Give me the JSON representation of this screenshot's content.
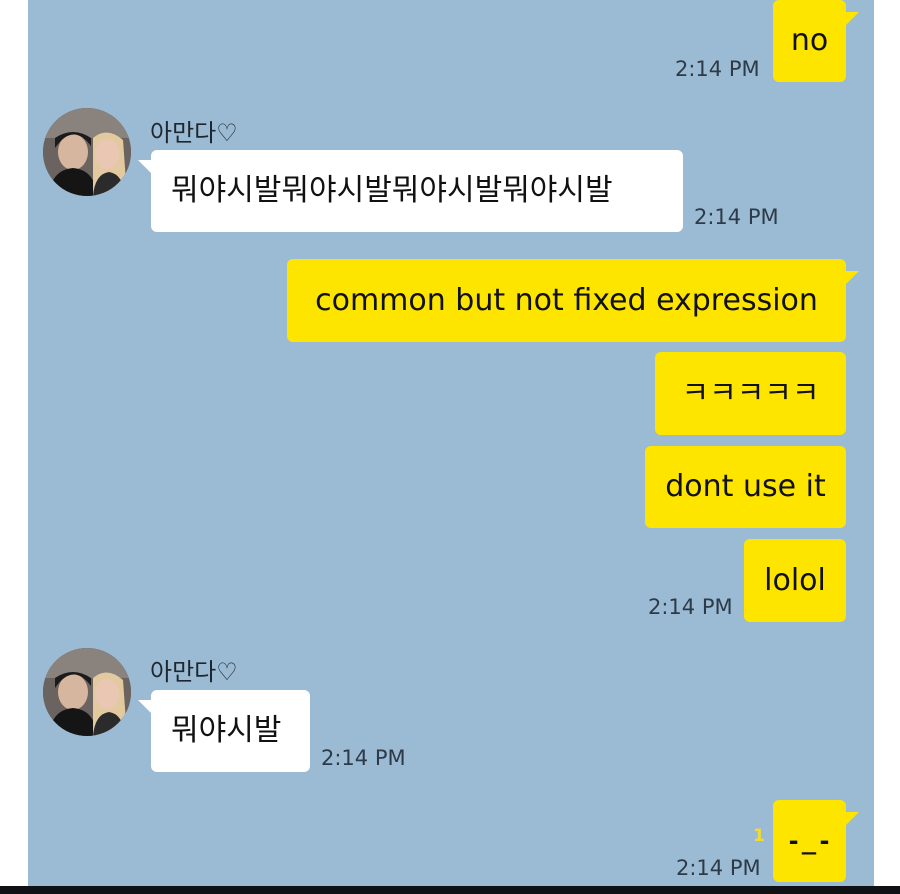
{
  "chat": {
    "messages": [
      {
        "text": "no",
        "time": "2:14 PM"
      },
      {
        "sender": "아만다♡",
        "text": "뭐야시발뭐야시발뭐야시발뭐야시발",
        "time": "2:14 PM"
      },
      {
        "text": "common but not fixed expression"
      },
      {
        "text": "ㅋㅋㅋㅋㅋ"
      },
      {
        "text": "dont use it"
      },
      {
        "text": "lolol",
        "time": "2:14 PM"
      },
      {
        "sender": "아만다♡",
        "text": "뭐야시발",
        "time": "2:14 PM"
      },
      {
        "text": "-_-",
        "time": "2:14 PM",
        "unread_count": "1"
      }
    ]
  },
  "colors": {
    "background": "#9bbbd4",
    "my_bubble": "#fee500",
    "their_bubble": "#ffffff",
    "unread": "#f2dc2e"
  },
  "icons": {
    "avatar": "profile-photo-avatar"
  }
}
